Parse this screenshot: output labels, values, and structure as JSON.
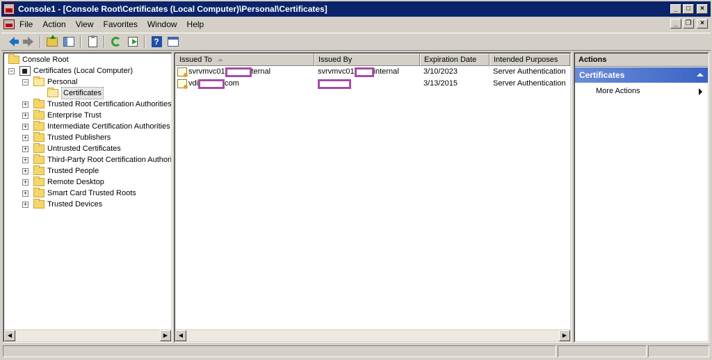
{
  "window": {
    "title": "Console1 - [Console Root\\Certificates (Local Computer)\\Personal\\Certificates]",
    "controls": [
      "_",
      "□",
      "×"
    ]
  },
  "menu": {
    "items": [
      {
        "label": "File"
      },
      {
        "label": "Action"
      },
      {
        "label": "View"
      },
      {
        "label": "Favorites"
      },
      {
        "label": "Window"
      },
      {
        "label": "Help"
      }
    ],
    "mdi_controls": [
      "_",
      "❐",
      "×"
    ]
  },
  "toolbar": {
    "icons": [
      "back-arrow-icon",
      "forward-arrow-icon",
      "up-one-level-icon",
      "show-hide-tree-icon",
      "properties-icon",
      "refresh-icon",
      "export-list-icon",
      "help-icon",
      "show-hide-action-pane-icon"
    ]
  },
  "tree": {
    "root": "Console Root",
    "store": "Certificates (Local Computer)",
    "personal": "Personal",
    "selected": "Certificates",
    "nodes": [
      "Trusted Root Certification Authorities",
      "Enterprise Trust",
      "Intermediate Certification Authorities",
      "Trusted Publishers",
      "Untrusted Certificates",
      "Third-Party Root Certification Authorities",
      "Trusted People",
      "Remote Desktop",
      "Smart Card Trusted Roots",
      "Trusted Devices"
    ]
  },
  "list": {
    "columns": [
      "Issued To",
      "Issued By",
      "Expiration Date",
      "Intended Purposes"
    ],
    "sorted_column": "Issued To",
    "rows": [
      {
        "issued_to_prefix": "svrvmvc01",
        "issued_to_suffix": "ternal",
        "issued_by_prefix": "svrvmvc01",
        "issued_by_suffix": "internal",
        "expiration": "3/10/2023",
        "purposes": "Server Authentication"
      },
      {
        "issued_to_prefix": "vdi",
        "issued_to_suffix": "com",
        "issued_by_prefix": "",
        "issued_by_suffix": "",
        "expiration": "3/13/2015",
        "purposes": "Server Authentication"
      }
    ]
  },
  "actions": {
    "header": "Actions",
    "section": "Certificates",
    "items": [
      "More Actions"
    ]
  },
  "colors": {
    "titlebar": "#0a246a",
    "redaction": "#a64ca6",
    "action_section": "#3a63c4"
  }
}
